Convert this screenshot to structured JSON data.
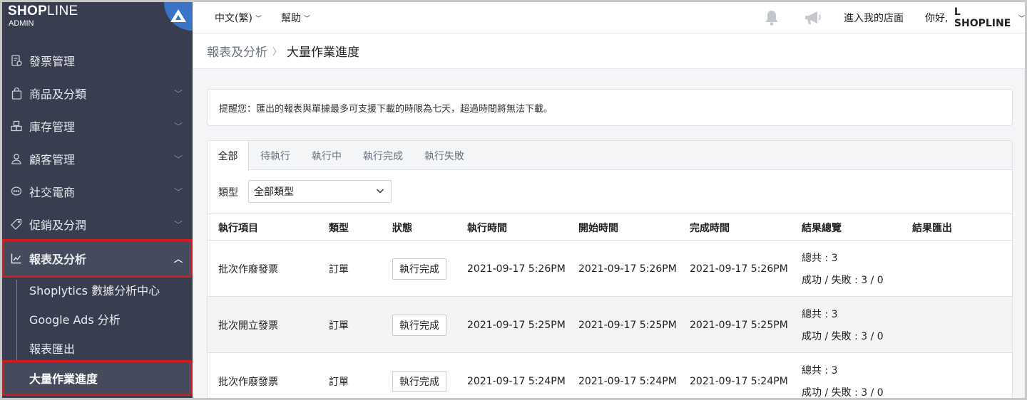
{
  "brand": {
    "name_bold": "SHOP",
    "name_light": "LINE",
    "subtitle": "ADMIN"
  },
  "sidebar": {
    "items": [
      {
        "label": "發票管理",
        "icon": "invoice-icon",
        "has_chevron": false
      },
      {
        "label": "商品及分類",
        "icon": "bag-icon",
        "has_chevron": true
      },
      {
        "label": "庫存管理",
        "icon": "boxes-icon",
        "has_chevron": true
      },
      {
        "label": "顧客管理",
        "icon": "user-icon",
        "has_chevron": true
      },
      {
        "label": "社交電商",
        "icon": "chat-icon",
        "has_chevron": true
      },
      {
        "label": "促銷及分潤",
        "icon": "tag-icon",
        "has_chevron": true
      },
      {
        "label": "報表及分析",
        "icon": "chart-icon",
        "has_chevron": true,
        "expanded": true
      }
    ],
    "sub_items": [
      {
        "label": "Shoplytics 數據分析中心"
      },
      {
        "label": "Google Ads 分析"
      },
      {
        "label": "報表匯出"
      },
      {
        "label": "大量作業進度"
      }
    ],
    "highlight_color": "#d91a1a"
  },
  "topbar": {
    "language": "中文(繁)",
    "help": "幫助",
    "store_link": "進入我的店面",
    "greeting_prefix": "你好, ",
    "user_name": "L SHOPLINE"
  },
  "breadcrumb": {
    "parent": "報表及分析",
    "current": "大量作業進度"
  },
  "notice": "提醒您：匯出的報表與單據最多可支援下載的時限為七天，超過時間將無法下載。",
  "tabs": [
    "全部",
    "待執行",
    "執行中",
    "執行完成",
    "執行失敗"
  ],
  "filter": {
    "label": "類型",
    "selected": "全部類型"
  },
  "table": {
    "headers": [
      "執行項目",
      "類型",
      "狀態",
      "執行時間",
      "開始時間",
      "完成時間",
      "結果總覽",
      "結果匯出"
    ],
    "rows": [
      {
        "item": "批次作廢發票",
        "type": "訂單",
        "status": "執行完成",
        "exec_time": "2021-09-17 5:26PM",
        "start_time": "2021-09-17 5:26PM",
        "end_time": "2021-09-17 5:26PM",
        "total": "總共 : 3",
        "result": "成功 / 失敗 : 3 / 0"
      },
      {
        "item": "批次開立發票",
        "type": "訂單",
        "status": "執行完成",
        "exec_time": "2021-09-17 5:25PM",
        "start_time": "2021-09-17 5:25PM",
        "end_time": "2021-09-17 5:25PM",
        "total": "總共 : 3",
        "result": "成功 / 失敗 : 3 / 0"
      },
      {
        "item": "批次作廢發票",
        "type": "訂單",
        "status": "執行完成",
        "exec_time": "2021-09-17 5:24PM",
        "start_time": "2021-09-17 5:24PM",
        "end_time": "2021-09-17 5:24PM",
        "total": "總共 : 3",
        "result": "成功 / 失敗 : 3 / 0"
      }
    ]
  }
}
